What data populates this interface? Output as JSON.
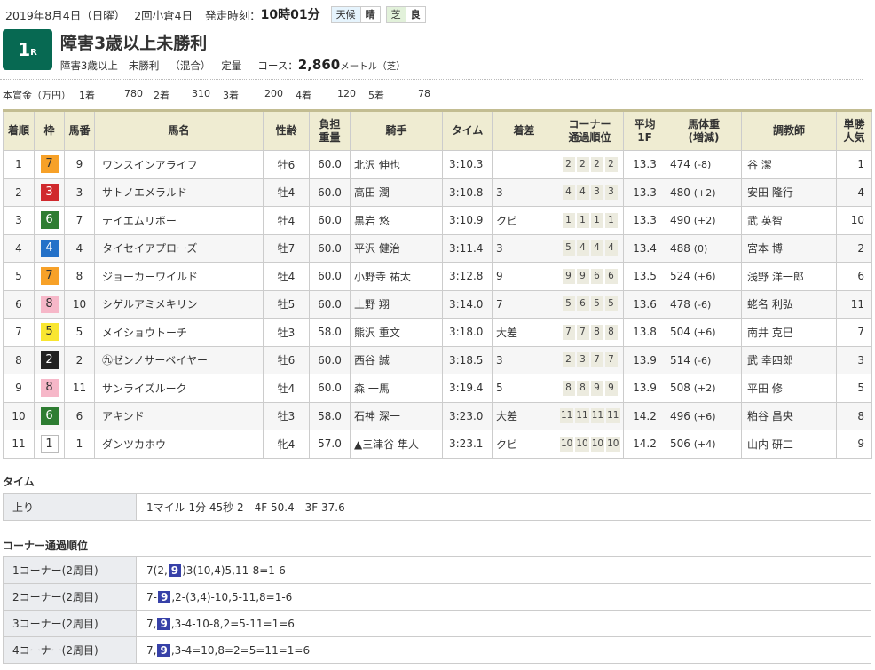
{
  "header": {
    "date": "2019年8月4日（日曜）",
    "meeting": "2回小倉4日",
    "start_label": "発走時刻：",
    "start_time": "10時01分",
    "weather_label": "天候",
    "weather_value": "晴",
    "track_label": "芝",
    "track_value": "良"
  },
  "race": {
    "number": "1",
    "number_suffix": "R",
    "title": "障害3歳以上未勝利",
    "class": "障害3歳以上",
    "condition": "未勝利",
    "mix": "（混合）",
    "weight_rule": "定量",
    "course_label": "コース：",
    "distance": "2,860",
    "distance_unit": "メートル（芝）",
    "badge_color": "#076952"
  },
  "prize": {
    "label": "本賞金（万円）",
    "items": [
      {
        "place": "1着",
        "amount": "780"
      },
      {
        "place": "2着",
        "amount": "310"
      },
      {
        "place": "3着",
        "amount": "200"
      },
      {
        "place": "4着",
        "amount": "120"
      },
      {
        "place": "5着",
        "amount": "78"
      }
    ]
  },
  "table": {
    "headers": [
      "着順",
      "枠",
      "馬番",
      "馬名",
      "性齢",
      "負担\n重量",
      "騎手",
      "タイム",
      "着差",
      "コーナー\n通過順位",
      "平均\n1F",
      "馬体重\n(増減)",
      "調教師",
      "単勝\n人気"
    ],
    "rows": [
      {
        "rank": "1",
        "waku": "7",
        "num": "9",
        "name": "ワンスインアライフ",
        "sexage": "牡6",
        "weight": "60.0",
        "jockey": "北沢 伸也",
        "time": "3:10.3",
        "margin": "",
        "corners": [
          "2",
          "2",
          "2",
          "2"
        ],
        "avg": "13.3",
        "body": "474",
        "change": "(-8)",
        "trainer": "谷 潔",
        "pop": "1"
      },
      {
        "rank": "2",
        "waku": "3",
        "num": "3",
        "name": "サトノエメラルド",
        "sexage": "牡4",
        "weight": "60.0",
        "jockey": "高田 潤",
        "time": "3:10.8",
        "margin": "3",
        "corners": [
          "4",
          "4",
          "3",
          "3"
        ],
        "avg": "13.3",
        "body": "480",
        "change": "(+2)",
        "trainer": "安田 隆行",
        "pop": "4"
      },
      {
        "rank": "3",
        "waku": "6",
        "num": "7",
        "name": "テイエムリボー",
        "sexage": "牡4",
        "weight": "60.0",
        "jockey": "黒岩 悠",
        "time": "3:10.9",
        "margin": "クビ",
        "corners": [
          "1",
          "1",
          "1",
          "1"
        ],
        "avg": "13.3",
        "body": "490",
        "change": "(+2)",
        "trainer": "武 英智",
        "pop": "10"
      },
      {
        "rank": "4",
        "waku": "4",
        "num": "4",
        "name": "タイセイアプローズ",
        "sexage": "牡7",
        "weight": "60.0",
        "jockey": "平沢 健治",
        "time": "3:11.4",
        "margin": "3",
        "corners": [
          "5",
          "4",
          "4",
          "4"
        ],
        "avg": "13.4",
        "body": "488",
        "change": "(0)",
        "trainer": "宮本 博",
        "pop": "2"
      },
      {
        "rank": "5",
        "waku": "7",
        "num": "8",
        "name": "ジョーカーワイルド",
        "sexage": "牡4",
        "weight": "60.0",
        "jockey": "小野寺 祐太",
        "time": "3:12.8",
        "margin": "9",
        "corners": [
          "9",
          "9",
          "6",
          "6"
        ],
        "avg": "13.5",
        "body": "524",
        "change": "(+6)",
        "trainer": "浅野 洋一郎",
        "pop": "6"
      },
      {
        "rank": "6",
        "waku": "8",
        "num": "10",
        "name": "シゲルアミメキリン",
        "sexage": "牡5",
        "weight": "60.0",
        "jockey": "上野 翔",
        "time": "3:14.0",
        "margin": "7",
        "corners": [
          "5",
          "6",
          "5",
          "5"
        ],
        "avg": "13.6",
        "body": "478",
        "change": "(-6)",
        "trainer": "蛯名 利弘",
        "pop": "11"
      },
      {
        "rank": "7",
        "waku": "5",
        "num": "5",
        "name": "メイショウトーチ",
        "sexage": "牡3",
        "weight": "58.0",
        "jockey": "熊沢 重文",
        "time": "3:18.0",
        "margin": "大差",
        "corners": [
          "7",
          "7",
          "8",
          "8"
        ],
        "avg": "13.8",
        "body": "504",
        "change": "(+6)",
        "trainer": "南井 克巳",
        "pop": "7"
      },
      {
        "rank": "8",
        "waku": "2",
        "num": "2",
        "name": "㊈ゼンノサーベイヤー",
        "sexage": "牡6",
        "weight": "60.0",
        "jockey": "西谷 誠",
        "time": "3:18.5",
        "margin": "3",
        "corners": [
          "2",
          "3",
          "7",
          "7"
        ],
        "avg": "13.9",
        "body": "514",
        "change": "(-6)",
        "trainer": "武 幸四郎",
        "pop": "3"
      },
      {
        "rank": "9",
        "waku": "8",
        "num": "11",
        "name": "サンライズルーク",
        "sexage": "牡4",
        "weight": "60.0",
        "jockey": "森 一馬",
        "time": "3:19.4",
        "margin": "5",
        "corners": [
          "8",
          "8",
          "9",
          "9"
        ],
        "avg": "13.9",
        "body": "508",
        "change": "(+2)",
        "trainer": "平田 修",
        "pop": "5"
      },
      {
        "rank": "10",
        "waku": "6",
        "num": "6",
        "name": "アキンド",
        "sexage": "牡3",
        "weight": "58.0",
        "jockey": "石神 深一",
        "time": "3:23.0",
        "margin": "大差",
        "corners": [
          "11",
          "11",
          "11",
          "11"
        ],
        "avg": "14.2",
        "body": "496",
        "change": "(+6)",
        "trainer": "粕谷 昌央",
        "pop": "8"
      },
      {
        "rank": "11",
        "waku": "1",
        "num": "1",
        "name": "ダンツカホウ",
        "sexage": "牝4",
        "weight": "57.0",
        "jockey": "▲三津谷 隼人",
        "time": "3:23.1",
        "margin": "クビ",
        "corners": [
          "10",
          "10",
          "10",
          "10"
        ],
        "avg": "14.2",
        "body": "506",
        "change": "(+4)",
        "trainer": "山内 研二",
        "pop": "9"
      }
    ]
  },
  "waku_colors": {
    "1": {
      "bg": "#ffffff",
      "fg": "#333333",
      "border": "#bbbbbb"
    },
    "2": {
      "bg": "#222222",
      "fg": "#ffffff"
    },
    "3": {
      "bg": "#d0292d",
      "fg": "#ffffff"
    },
    "4": {
      "bg": "#2471c8",
      "fg": "#ffffff"
    },
    "5": {
      "bg": "#f9e630",
      "fg": "#333333"
    },
    "6": {
      "bg": "#2e7d32",
      "fg": "#ffffff"
    },
    "7": {
      "bg": "#f7a128",
      "fg": "#333333"
    },
    "8": {
      "bg": "#f6b7c8",
      "fg": "#333333"
    }
  },
  "time_section": {
    "title": "タイム",
    "rows": [
      {
        "label": "上り",
        "value": "1マイル 1分 45秒 2　4F 50.4 - 3F 37.6"
      }
    ]
  },
  "corner_section": {
    "title": "コーナー通過順位",
    "highlight_horse": "9",
    "highlight_color": "#3741a8",
    "rows": [
      {
        "label": "1コーナー(2周目)",
        "parts": [
          "7(2,",
          "9",
          ")3(10,4)5,11-8=1-6"
        ]
      },
      {
        "label": "2コーナー(2周目)",
        "parts": [
          "7-",
          "9",
          ",2-(3,4)-10,5-11,8=1-6"
        ]
      },
      {
        "label": "3コーナー(2周目)",
        "parts": [
          "7,",
          "9",
          ",3-4-10-8,2=5-11=1=6"
        ]
      },
      {
        "label": "4コーナー(2周目)",
        "parts": [
          "7,",
          "9",
          ",3-4=10,8=2=5=11=1=6"
        ]
      }
    ]
  }
}
